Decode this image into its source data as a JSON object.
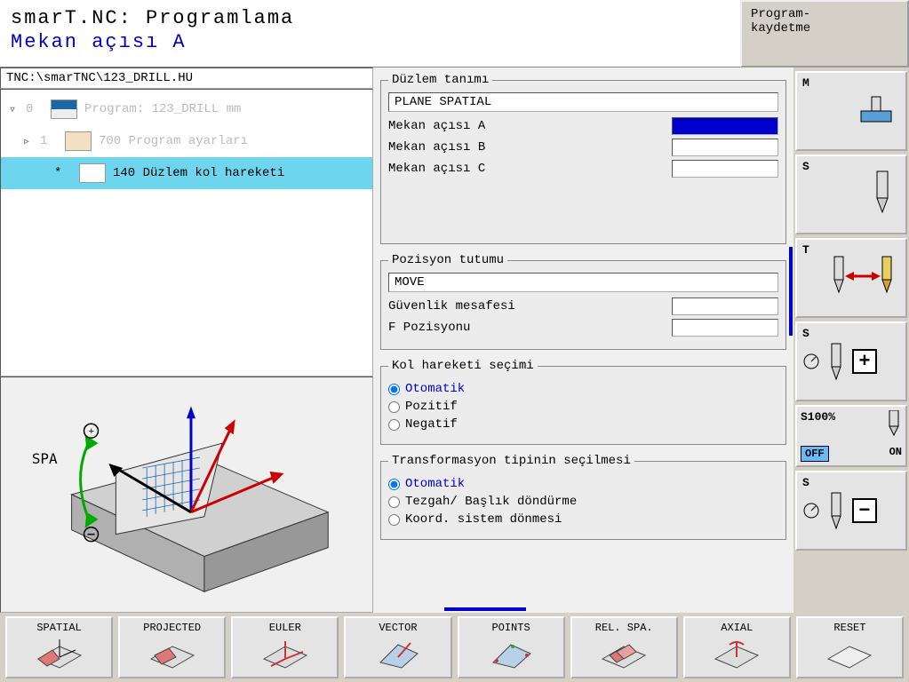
{
  "header": {
    "title": "smarT.NC: Programlama",
    "subtitle": "Mekan açısı A",
    "mode": "Program-\nkaydetme"
  },
  "path": "TNC:\\smarTNC\\123_DRILL.HU",
  "tree": [
    {
      "exp": "▿",
      "idx": "0",
      "label": "Program: 123_DRILL mm"
    },
    {
      "exp": "▹",
      "idx": "1",
      "label": "700 Program ayarları"
    },
    {
      "exp": "",
      "idx": "*",
      "label": "140 Düzlem kol hareketi"
    }
  ],
  "preview": {
    "label": "SPA"
  },
  "plane_def": {
    "legend": "Düzlem tanımı",
    "mode": "PLANE SPATIAL",
    "rows": [
      {
        "label": "Mekan açısı A",
        "value": "",
        "active": true
      },
      {
        "label": "Mekan açısı B",
        "value": ""
      },
      {
        "label": "Mekan açısı C",
        "value": ""
      }
    ]
  },
  "pos_mode": {
    "legend": "Pozisyon tutumu",
    "mode": "MOVE",
    "rows": [
      {
        "label": "Güvenlik mesafesi",
        "value": ""
      },
      {
        "label": "F Pozisyonu",
        "value": ""
      }
    ]
  },
  "swivel": {
    "legend": "Kol hareketi seçimi",
    "options": [
      {
        "label": "Otomatik",
        "selected": true
      },
      {
        "label": "Pozitif",
        "selected": false
      },
      {
        "label": "Negatif",
        "selected": false
      }
    ]
  },
  "transform": {
    "legend": "Transformasyon tipinin seçilmesi",
    "options": [
      {
        "label": "Otomatik",
        "selected": true
      },
      {
        "label": "Tezgah/ Başlık döndürme",
        "selected": false
      },
      {
        "label": "Koord. sistem dönmesi",
        "selected": false
      }
    ]
  },
  "side": {
    "m": "M",
    "s1": "S",
    "t": "T",
    "s2": "S",
    "s100": "S100%",
    "off": "OFF",
    "on": "ON",
    "s3": "S"
  },
  "softkeys": [
    "SPATIAL",
    "PROJECTED",
    "EULER",
    "VECTOR",
    "POINTS",
    "REL. SPA.",
    "AXIAL",
    "RESET"
  ]
}
